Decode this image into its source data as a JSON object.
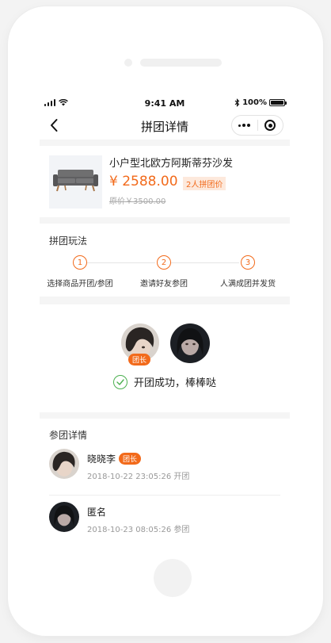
{
  "status_bar": {
    "time": "9:41 AM",
    "battery": "100%",
    "battery_level": 1.0
  },
  "nav": {
    "title": "拼团详情",
    "icons": [
      "chevron-left-icon",
      "more-dots-icon",
      "target-icon"
    ]
  },
  "product": {
    "name": "小户型北欧方阿斯蒂芬沙发",
    "price": "¥ 2588.00",
    "group_tag": "2人拼团价",
    "original_price": "原价￥3500.00"
  },
  "rules": {
    "title": "拼团玩法",
    "steps": [
      {
        "number": "1",
        "label": "选择商品开团/参团"
      },
      {
        "number": "2",
        "label": "邀请好友参团"
      },
      {
        "number": "3",
        "label": "人满成团并发货"
      }
    ]
  },
  "success": {
    "leader_badge": "团长",
    "message": "开团成功，棒棒哒"
  },
  "participants": {
    "title": "参团详情",
    "list": [
      {
        "name": "晓晓李",
        "badge": "团长",
        "meta": "2018-10-22 23:05:26 开团"
      },
      {
        "name": "匿名",
        "meta": "2018-10-23 08:05:26 参团"
      }
    ]
  },
  "colors": {
    "accent": "#f26a1b",
    "success": "#4cb050",
    "background": "#f5f5f5"
  }
}
